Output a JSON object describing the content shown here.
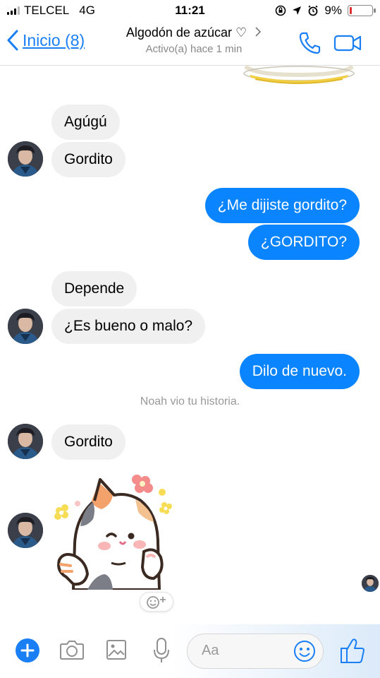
{
  "status_bar": {
    "carrier": "TELCEL",
    "network": "4G",
    "time": "11:21",
    "battery_percent": "9%",
    "battery_level": 0.09,
    "battery_color": "#e03030"
  },
  "header": {
    "back_label": "Inicio (8)",
    "title": "Algodón de azúcar ♡",
    "subtitle": "Activo(a) hace 1 min",
    "accent_color": "#1a7ff5"
  },
  "messages": [
    {
      "from": "them",
      "text": "Agúgú"
    },
    {
      "from": "them",
      "text": "Gordito"
    },
    {
      "from": "me",
      "text": "¿Me dijiste gordito?"
    },
    {
      "from": "me",
      "text": "¿GORDITO?"
    },
    {
      "from": "them",
      "text": "Depende"
    },
    {
      "from": "them",
      "text": "¿Es bueno o malo?"
    },
    {
      "from": "me",
      "text": "Dilo de nuevo."
    },
    {
      "from": "them",
      "text": "Gordito"
    }
  ],
  "seen_note": "Noah vio tu historia.",
  "sticker": {
    "icon": "cat-sticker-icon"
  },
  "composer": {
    "placeholder": "Aa",
    "icons": [
      "plus-icon",
      "camera-icon",
      "image-icon",
      "microphone-icon",
      "emoji-icon",
      "thumbs-up-icon"
    ]
  },
  "colors": {
    "outgoing_bubble": "#0a84ff",
    "incoming_bubble": "#f0f0f0"
  }
}
